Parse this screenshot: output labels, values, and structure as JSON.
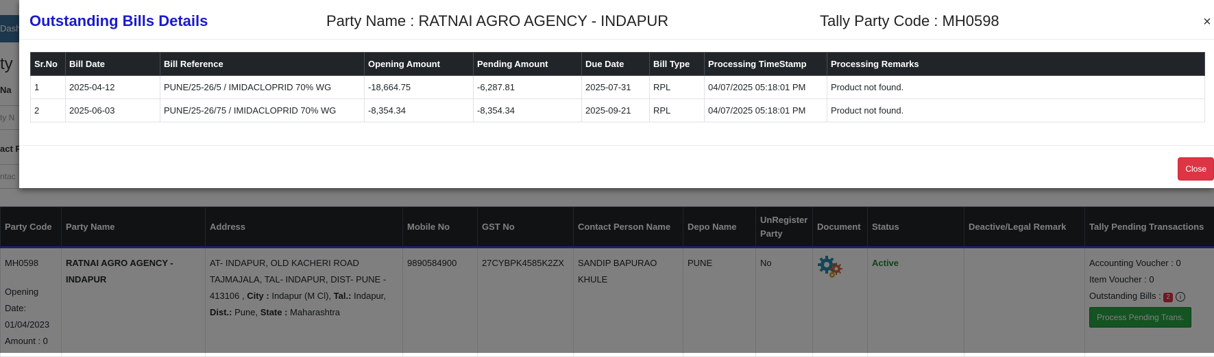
{
  "background": {
    "dash_btn": "Dashboa",
    "frag_heading": "ty",
    "frag_name_label": "Na",
    "frag_name_input": "ty N",
    "frag_contact_label": "act P",
    "frag_contact_input": "ntac",
    "table": {
      "headers": [
        "Party Code",
        "Party Name",
        "Address",
        "Mobile No",
        "GST No",
        "Contact Person Name",
        "Depo Name",
        "UnRegister Party",
        "Document",
        "Status",
        "Deactive/Legal Remark",
        "Tally Pending Transactions"
      ],
      "row": {
        "party_code": "MH0598",
        "opening_date_label": "Opening Date:",
        "opening_date": "01/04/2023",
        "amount_label": "Amount : 0",
        "party_name": "RATNAI AGRO AGENCY - INDAPUR",
        "address_prefix": "AT- INDAPUR, OLD KACHERI ROAD TAJMAJALA, TAL- INDAPUR, DIST- PUNE - 413106 , ",
        "city_label": "City :",
        "city_value": " Indapur (M Cl), ",
        "tal_label": "Tal.:",
        "tal_value": " Indapur, ",
        "dist_label": "Dist.:",
        "dist_value": " Pune, ",
        "state_label": "State :",
        "state_value": " Maharashtra",
        "mobile": "9890584900",
        "gst": "27CYBPK4585K2ZX",
        "contact_person": "SANDIP BAPURAO KHULE",
        "depo": "PUNE",
        "unregister": "No",
        "document_icon": "gears-icon",
        "status": "Active",
        "remark": "",
        "accounting_voucher": "Accounting Voucher : 0",
        "item_voucher": "Item Voucher : 0",
        "outstanding_label": "Outstanding Bills :",
        "outstanding_count": "2",
        "info_icon": "i",
        "process_button": "Process Pending Trans."
      }
    }
  },
  "modal": {
    "title": "Outstanding Bills Details",
    "party_name": "Party Name : RATNAI AGRO AGENCY - INDAPUR",
    "tally_code": "Tally Party Code : MH0598",
    "close_x": "×",
    "close_button": "Close",
    "columns": [
      "Sr.No",
      "Bill Date",
      "Bill Reference",
      "Opening Amount",
      "Pending Amount",
      "Due Date",
      "Bill Type",
      "Processing TimeStamp",
      "Processing Remarks"
    ],
    "rows": [
      [
        "1",
        "2025-04-12",
        "PUNE/25-26/5 / IMIDACLOPRID 70% WG",
        "-18,664.75",
        "-6,287.81",
        "2025-07-31",
        "RPL",
        "04/07/2025 05:18:01 PM",
        "Product not found."
      ],
      [
        "2",
        "2025-06-03",
        "PUNE/25-26/75 / IMIDACLOPRID 70% WG",
        "-8,354.34",
        "-8,354.34",
        "2025-09-21",
        "RPL",
        "04/07/2025 05:18:01 PM",
        "Product not found."
      ]
    ]
  },
  "colors": {
    "title_blue": "#1a1acc",
    "header_dark": "#212529",
    "danger": "#dc3545",
    "success": "#28a745",
    "active_green": "#1a8a2a"
  }
}
